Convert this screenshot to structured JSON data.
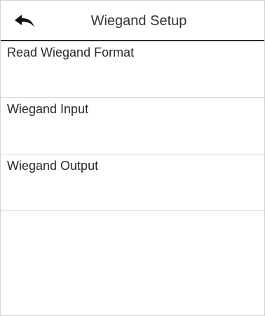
{
  "header": {
    "title": "Wiegand Setup",
    "back_icon": "back-arrow-icon"
  },
  "menu": {
    "items": [
      {
        "label": "Read Wiegand Format"
      },
      {
        "label": "Wiegand Input"
      },
      {
        "label": "Wiegand Output"
      }
    ]
  },
  "colors": {
    "background": "#ffffff",
    "text": "#2a2a2a",
    "separator": "#dcdcdc",
    "header_rule": "#2b2b2b"
  }
}
